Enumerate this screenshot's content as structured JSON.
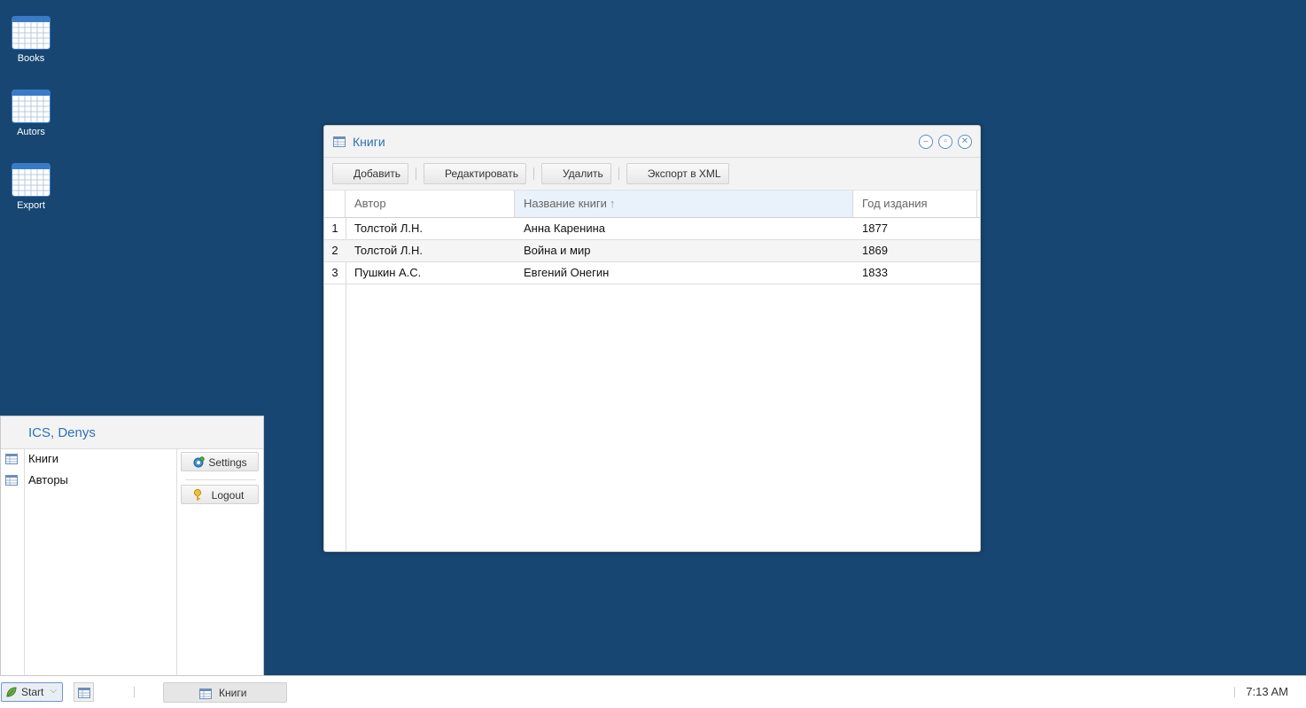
{
  "desktop": {
    "icons": [
      {
        "label": "Books"
      },
      {
        "label": "Autors"
      },
      {
        "label": "Export"
      }
    ]
  },
  "window": {
    "title": "Книги",
    "toolbar": {
      "add": "Добавить",
      "edit": "Редактировать",
      "delete": "Удалить",
      "export": "Экспорт в XML"
    },
    "grid": {
      "columns": [
        "Автор",
        "Название книги",
        "Год издания"
      ],
      "sorted_column": "Название книги",
      "sort_direction": "ascending",
      "rows": [
        {
          "n": "1",
          "author": "Толстой Л.Н.",
          "title": "Анна Каренина",
          "year": "1877"
        },
        {
          "n": "2",
          "author": "Толстой Л.Н.",
          "title": "Война и мир",
          "year": "1869"
        },
        {
          "n": "3",
          "author": "Пушкин А.С.",
          "title": "Евгений Онегин",
          "year": "1833"
        }
      ]
    }
  },
  "start_menu": {
    "user": "ICS, Denys",
    "items": [
      {
        "label": "Книги"
      },
      {
        "label": "Авторы"
      }
    ],
    "settings": "Settings",
    "logout": "Logout"
  },
  "taskbar": {
    "start": "Start",
    "task": "Книги",
    "clock": "7:13 AM"
  },
  "colors": {
    "desktop_bg": "#174672",
    "accent": "#2d72b8"
  }
}
